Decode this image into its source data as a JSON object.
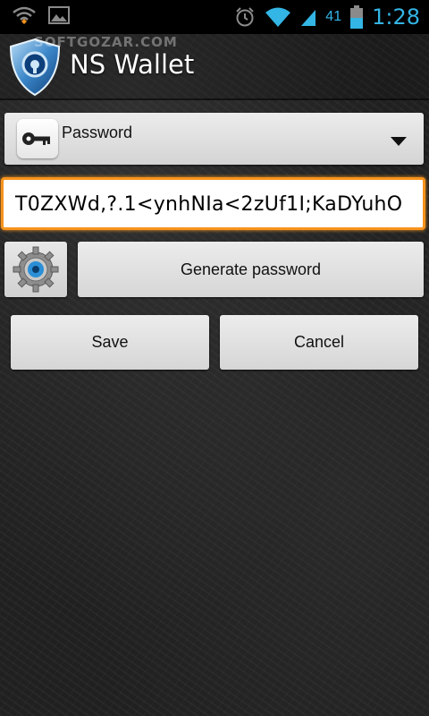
{
  "status_bar": {
    "battery_percent": "41",
    "time": "1:28",
    "icons": [
      "wifi-stats-icon",
      "image-notification-icon",
      "alarm-icon",
      "wifi-signal-icon",
      "cell-signal-icon",
      "battery-icon"
    ]
  },
  "action_bar": {
    "title": "NS Wallet",
    "watermark": "SOFTGOZAR.COM",
    "logo_icon": "shield-lock-icon"
  },
  "type_selector": {
    "selected": "Password",
    "icon": "key-icon"
  },
  "password_field": {
    "value": "T0ZXWd,?.1<ynhNIa<2zUf1I;KaDYuhO"
  },
  "buttons": {
    "settings_icon": "gear-icon",
    "generate_label": "Generate password",
    "save_label": "Save",
    "cancel_label": "Cancel"
  },
  "colors": {
    "accent": "#33b5e5",
    "focus_border": "#f7941d"
  }
}
